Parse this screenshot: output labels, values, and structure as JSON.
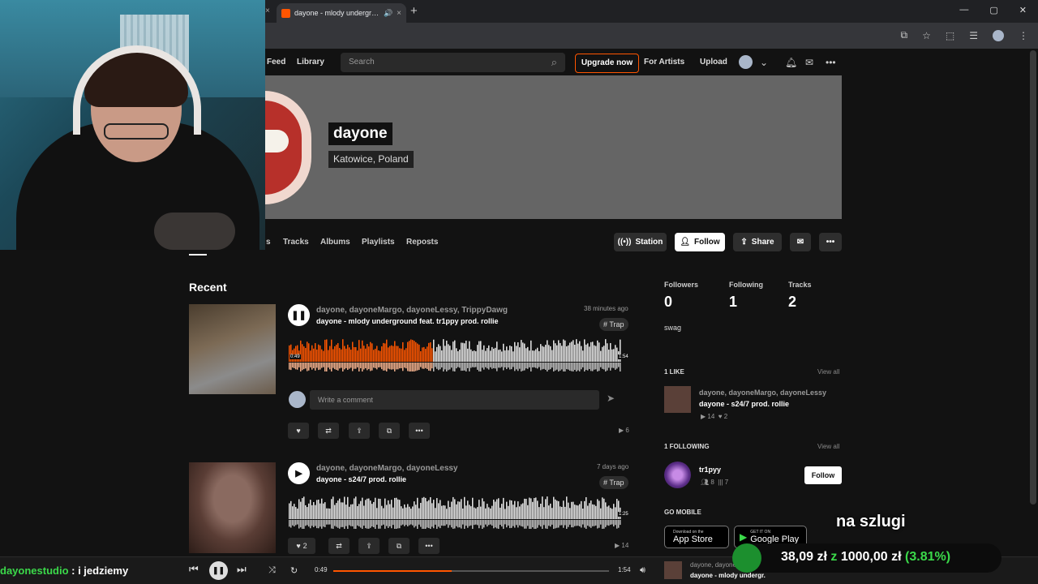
{
  "browser": {
    "tab_title": "dayone - mlody undergrou",
    "tab_close": "×",
    "prev_tab_close": "×",
    "new_tab": "+",
    "window": {
      "minimize": "—",
      "maximize": "▢",
      "close": "✕"
    }
  },
  "header": {
    "nav": [
      "Feed",
      "Library"
    ],
    "search_placeholder": "Search",
    "upgrade_label": "Upgrade now",
    "for_artists": "For Artists",
    "upload": "Upload"
  },
  "profile": {
    "name": "dayone",
    "location": "Katowice, Poland",
    "tabs": [
      "s",
      "Tracks",
      "Albums",
      "Playlists",
      "Reposts"
    ],
    "buttons": {
      "station": "Station",
      "follow": "Follow",
      "share": "Share"
    }
  },
  "recent": {
    "heading": "Recent",
    "tracks": [
      {
        "artists": "dayone, dayoneMargo, dayoneLessy, TrippyDawg",
        "title": "dayone - mlody underground feat. tr1ppy prod. rollie",
        "ago": "38 minutes ago",
        "tag": "# Trap",
        "time_current": "0:49",
        "time_total": "1:54",
        "progress": 0.43,
        "playing": true,
        "plays": "6",
        "likes": ""
      },
      {
        "artists": "dayone, dayoneMargo, dayoneLessy",
        "title": "dayone - s24/7 prod. rollie",
        "ago": "7 days ago",
        "tag": "# Trap",
        "time_current": "",
        "time_total": "1:25",
        "progress": 0,
        "playing": false,
        "plays": "14",
        "likes": "2"
      }
    ],
    "comment_placeholder": "Write a comment"
  },
  "sidebar": {
    "stats": [
      {
        "label": "Followers",
        "value": "0"
      },
      {
        "label": "Following",
        "value": "1"
      },
      {
        "label": "Tracks",
        "value": "2"
      }
    ],
    "bio": "swag",
    "likes_heading": "1 LIKE",
    "view_all": "View all",
    "liked": {
      "artists": "dayone, dayoneMargo, dayoneLessy",
      "title": "dayone - s24/7 prod. rollie",
      "plays": "14",
      "likes": "2"
    },
    "following_heading": "1 FOLLOWING",
    "following": {
      "name": "tr1pyy",
      "followers": "8",
      "tracks": "7",
      "follow_label": "Follow"
    },
    "mobile_heading": "GO MOBILE",
    "app_store": {
      "small": "Download on the",
      "large": "App Store"
    },
    "google_play": {
      "small": "GET IT ON",
      "large": "Google Play"
    }
  },
  "player": {
    "time_current": "0:49",
    "time_total": "1:54",
    "progress": 0.43,
    "now_artists": "dayone, dayoneMargo,",
    "now_title": "dayone - mlody undergr."
  },
  "stream": {
    "chat_user": "dayonestudio",
    "chat_message": " : i jedziemy",
    "overlay_text": "na szlugi",
    "donation": {
      "amount": "38,09 zł",
      "z": "z",
      "goal": "1000,00 zł",
      "percent": "(3.81%)"
    }
  },
  "colors": {
    "accent": "#ff5500",
    "bg": "#121212",
    "overlay_green": "#3bd94a"
  }
}
